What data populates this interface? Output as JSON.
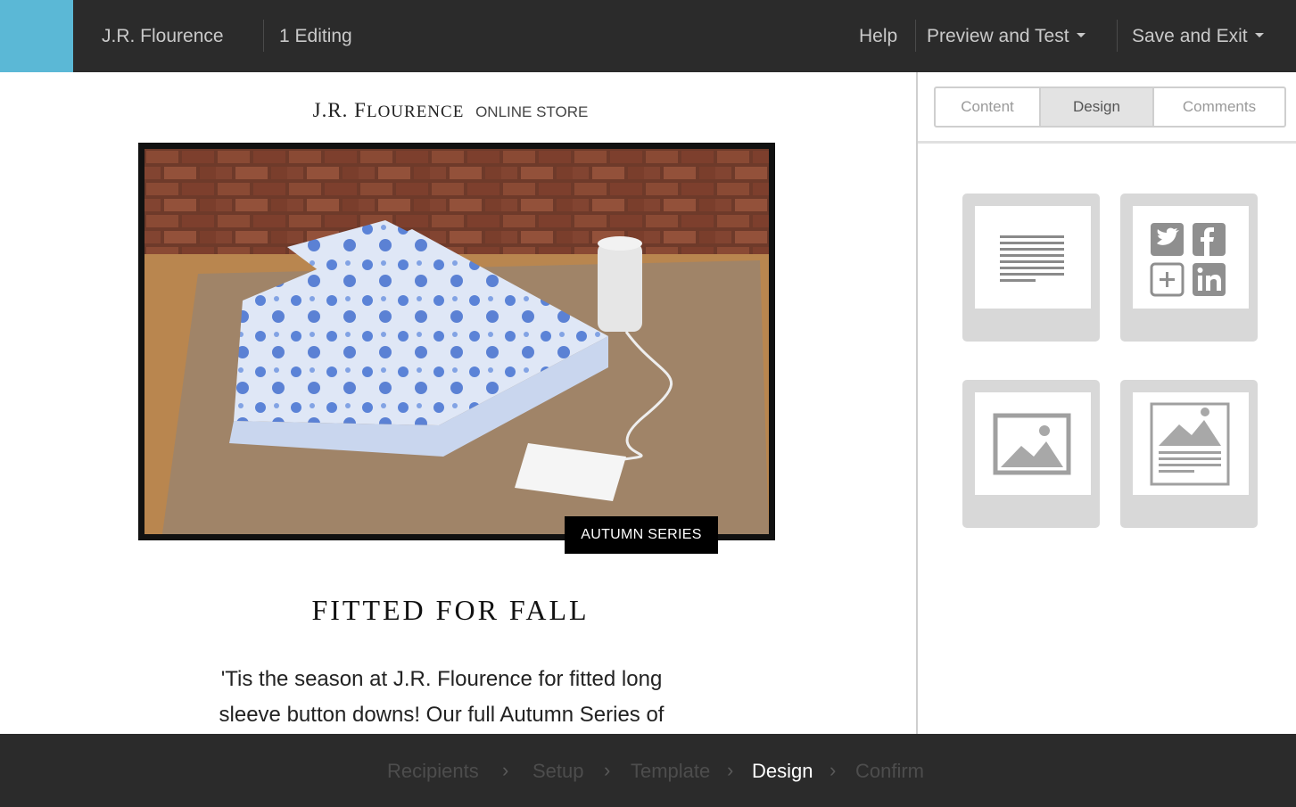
{
  "header": {
    "account_name": "J.R. Flourence",
    "editing_status": "1 Editing",
    "help_label": "Help",
    "preview_label": "Preview and Test",
    "save_label": "Save and Exit"
  },
  "email": {
    "brand_first": "J.R. F",
    "brand_rest": "LOURENCE",
    "brand_sub": "ONLINE STORE",
    "hero_badge": "AUTUMN SERIES",
    "headline": "FITTED FOR FALL",
    "body_line1": "'Tis the season at J.R. Flourence for fitted long",
    "body_line2": "sleeve button downs! Our full Autumn Series of"
  },
  "panel": {
    "tabs": [
      {
        "label": "Content",
        "active": false
      },
      {
        "label": "Design",
        "active": true
      },
      {
        "label": "Comments",
        "active": false
      }
    ],
    "blocks": [
      {
        "icon": "text-block-icon"
      },
      {
        "icon": "social-block-icon"
      },
      {
        "icon": "image-block-icon"
      },
      {
        "icon": "image-text-block-icon"
      }
    ]
  },
  "wizard": {
    "steps": [
      {
        "label": "Recipients",
        "active": false
      },
      {
        "label": "Setup",
        "active": false
      },
      {
        "label": "Template",
        "active": false
      },
      {
        "label": "Design",
        "active": true
      },
      {
        "label": "Confirm",
        "active": false
      }
    ]
  },
  "colors": {
    "accent": "#5bb8d6",
    "bar": "#2b2b2b"
  }
}
